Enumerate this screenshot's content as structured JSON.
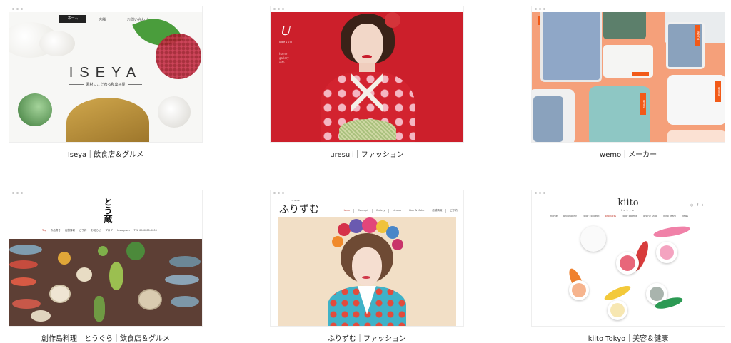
{
  "cards": [
    {
      "caption": "Iseya｜飲食店＆グルメ",
      "nav": [
        "ホーム",
        "店舗",
        "お問い合わせ"
      ],
      "logo": "ISEYA",
      "tagline": "素材にこだわる和菓子屋"
    },
    {
      "caption": "uresuji｜ファッション",
      "logo": "U",
      "logo_sub": "URESUJI",
      "menu": [
        "home",
        "gallery",
        "info"
      ]
    },
    {
      "caption": "wemo｜メーカー",
      "tag": "wemo"
    },
    {
      "caption": "創作島料理　とうぐら｜飲食店＆グルメ",
      "logo": "とう蔵",
      "nav": [
        "Top",
        "お品書き",
        "店舗情報",
        "ご予約",
        "お知らせ",
        "ブログ",
        "Instagram"
      ],
      "phone": "TEL 0980-00-0000"
    },
    {
      "caption": "ふりずむ｜ファッション",
      "logo": "ふりずむ",
      "logo_small": "Furisode",
      "nav": [
        "Home",
        "Concept",
        "Gallery",
        "Lineup",
        "Hair & Make",
        "店舗情報",
        "ご予約"
      ]
    },
    {
      "caption": "kiito Tokyo｜美容＆健康",
      "logo": "kiito",
      "logo_sub": "tokyo",
      "nav": [
        "home",
        "philosophy",
        "color concept",
        "products",
        "color palette",
        "online shop",
        "kiito team",
        "news"
      ],
      "social": [
        "◎",
        "f",
        "t"
      ]
    }
  ],
  "colors": {
    "uresuji_bg": "#cc1f2b",
    "wemo_bg": "#f5a07a",
    "wemo_orange": "#f25a18",
    "tougura_bg": "#5d3f35"
  }
}
